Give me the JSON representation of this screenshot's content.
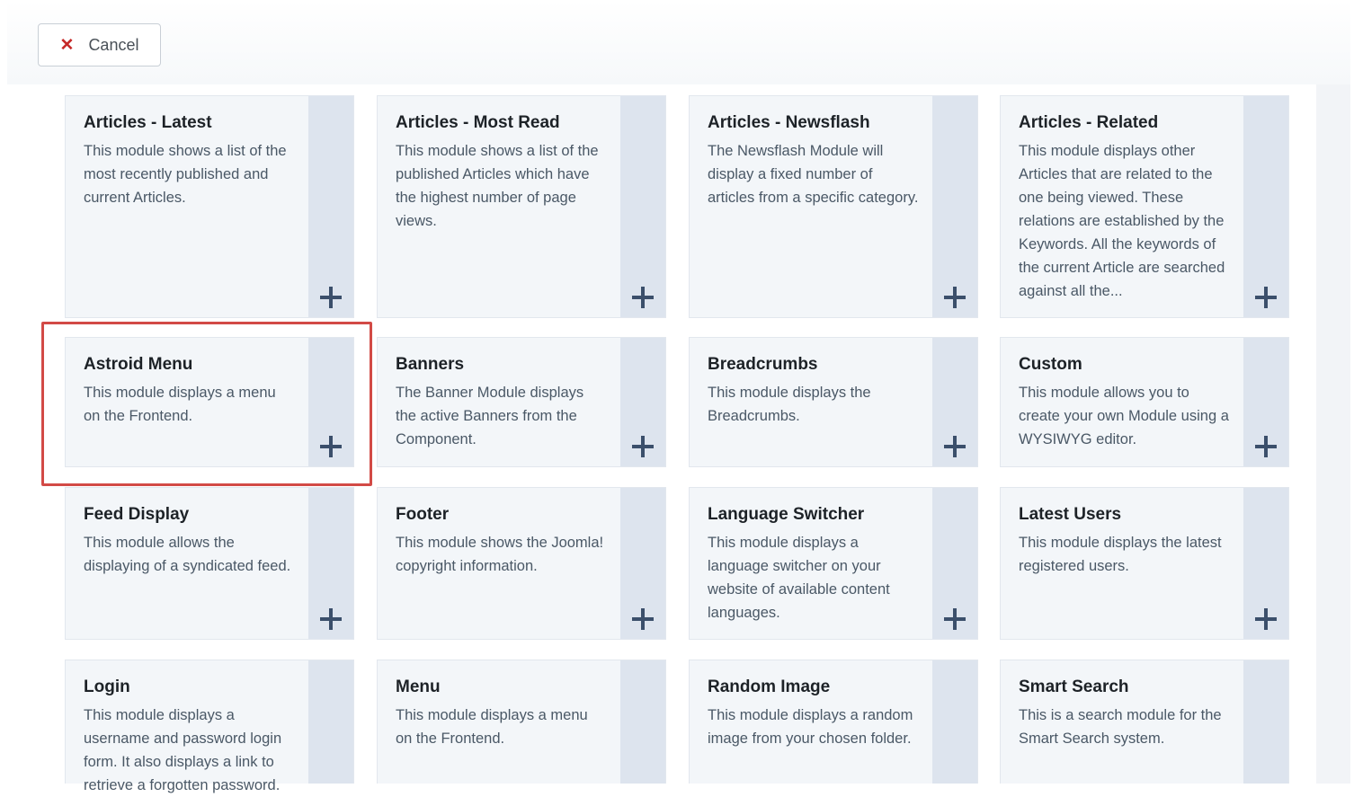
{
  "toolbar": {
    "cancel_label": "Cancel",
    "cancel_icon": "close-icon"
  },
  "modules": [
    {
      "title": "Articles - Latest",
      "description": "This module shows a list of the most recently published and current Articles."
    },
    {
      "title": "Articles - Most Read",
      "description": "This module shows a list of the published Articles which have the highest number of page views."
    },
    {
      "title": "Articles - Newsflash",
      "description": "The Newsflash Module will display a fixed number of articles from a specific category."
    },
    {
      "title": "Articles - Related",
      "description": "This module displays other Articles that are related to the one being viewed. These relations are established by the Keywords. All the keywords of the current Article are searched against all the..."
    },
    {
      "title": "Astroid Menu",
      "description": "This module displays a menu on the Frontend."
    },
    {
      "title": "Banners",
      "description": "The Banner Module displays the active Banners from the Component."
    },
    {
      "title": "Breadcrumbs",
      "description": "This module displays the Breadcrumbs."
    },
    {
      "title": "Custom",
      "description": "This module allows you to create your own Module using a WYSIWYG editor."
    },
    {
      "title": "Feed Display",
      "description": "This module allows the displaying of a syndicated feed."
    },
    {
      "title": "Footer",
      "description": "This module shows the Joomla! copyright information."
    },
    {
      "title": "Language Switcher",
      "description": "This module displays a language switcher on your website of available content languages."
    },
    {
      "title": "Latest Users",
      "description": "This module displays the latest registered users."
    },
    {
      "title": "Login",
      "description": "This module displays a username and password login form. It also displays a link to retrieve a forgotten password."
    },
    {
      "title": "Menu",
      "description": "This module displays a menu on the Frontend."
    },
    {
      "title": "Random Image",
      "description": "This module displays a random image from your chosen folder."
    },
    {
      "title": "Smart Search",
      "description": "This is a search module for the Smart Search system."
    }
  ],
  "colors": {
    "highlight": "#d24a46",
    "accent": "#3b4f6b",
    "cancel_icon": "#c52827"
  }
}
